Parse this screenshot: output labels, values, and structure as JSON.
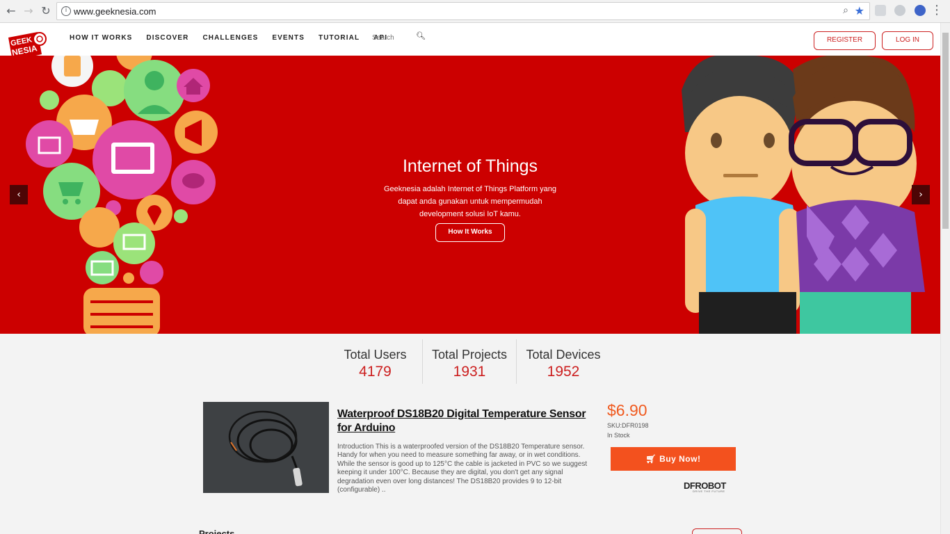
{
  "browser": {
    "url": "www.geeknesia.com",
    "back_icon": "←",
    "forward_icon": "→",
    "reload_icon": "↻",
    "menu_icon": "⋮"
  },
  "header": {
    "logo_line1": "GEEK",
    "logo_line2": "NESIA",
    "nav": [
      "HOW IT WORKS",
      "DISCOVER",
      "CHALLENGES",
      "EVENTS",
      "TUTORIAL",
      "API"
    ],
    "search_placeholder": "Search",
    "register": "REGISTER",
    "login": "LOG IN"
  },
  "hero": {
    "title": "Internet of Things",
    "description": "Geeknesia adalah Internet of Things Platform yang dapat anda gunakan untuk mempermudah development solusi IoT kamu.",
    "button": "How It Works",
    "prev": "‹",
    "next": "›"
  },
  "stats": [
    {
      "label": "Total Users",
      "value": "4179"
    },
    {
      "label": "Total Projects",
      "value": "1931"
    },
    {
      "label": "Total Devices",
      "value": "1952"
    }
  ],
  "product": {
    "title": "Waterproof DS18B20 Digital Temperature Sensor for Arduino",
    "description": "Introduction This is a waterproofed version of the DS18B20 Temperature sensor. Handy for when you need to measure something far away, or in wet conditions. While the sensor is good up to 125°C the cable is jacketed in PVC so we suggest keeping it under 100°C. Because they are digital, you don't get any signal degradation even over long distances! The DS18B20 provides 9 to 12-bit (configurable) ..",
    "price": "$6.90",
    "sku": "SKU:DFR0198",
    "stock": "In Stock",
    "buy": "Buy Now!",
    "brand": "DFROBOT",
    "brand_tagline": "DRIVE THE FUTURE"
  },
  "sections": {
    "projects": "Projects"
  },
  "colors": {
    "brand_red": "#cc0000",
    "accent": "#cc1f1f",
    "buy_orange": "#f3511e"
  }
}
